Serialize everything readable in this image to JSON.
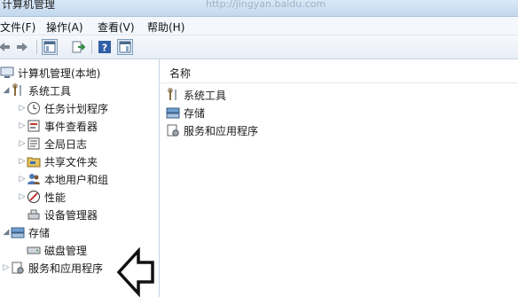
{
  "window": {
    "title": "计算机管理",
    "watermark": "http://jingyan.baidu.com"
  },
  "menubar": {
    "items": [
      "文件(F)",
      "操作(A)",
      "查看(V)",
      "帮助(H)"
    ]
  },
  "tree": {
    "root": "计算机管理(本地)",
    "system_tools": "系统工具",
    "task_scheduler": "任务计划程序",
    "event_viewer": "事件查看器",
    "global_log": "全局日志",
    "shared_folders": "共享文件夹",
    "local_users_groups": "本地用户和组",
    "performance": "性能",
    "device_manager": "设备管理器",
    "storage": "存储",
    "disk_management": "磁盘管理",
    "services_apps": "服务和应用程序"
  },
  "list": {
    "header_name": "名称",
    "items": [
      "系统工具",
      "存储",
      "服务和应用程序"
    ]
  },
  "colors": {
    "accent": "#3a78c8",
    "toolbar": "#e8eef6"
  }
}
